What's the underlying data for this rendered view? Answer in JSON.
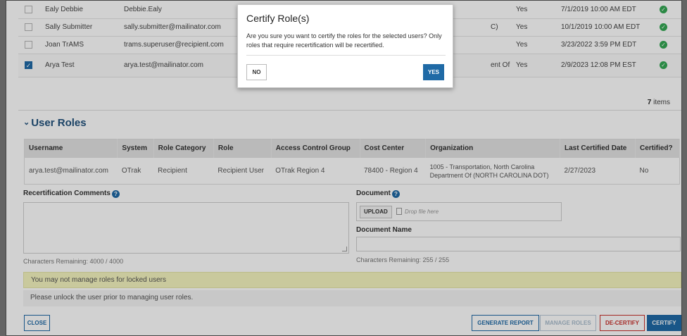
{
  "users": {
    "rows": [
      {
        "name": "Ealy Debbie",
        "username": "Debbie.Ealy",
        "col6": "",
        "col7": "Yes",
        "date": "7/1/2019 10:00 AM EDT",
        "checked": false
      },
      {
        "name": "Sally Submitter",
        "username": "sally.submitter@mailinator.com",
        "col6": "C)",
        "col7": "Yes",
        "date": "10/1/2019 10:00 AM EDT",
        "checked": false
      },
      {
        "name": "Joan TrAMS",
        "username": "trams.superuser@recipient.com",
        "col6": "",
        "col7": "Yes",
        "date": "3/23/2022 3:59 PM EDT",
        "checked": false
      },
      {
        "name": "Arya Test",
        "username": "arya.test@mailinator.com",
        "col6": "ent Of",
        "col7": "Yes",
        "date": "2/9/2023 12:08 PM EST",
        "checked": true
      }
    ],
    "count": "7",
    "count_suffix": " items"
  },
  "user_roles": {
    "title": "User Roles",
    "headers": [
      "Username",
      "System",
      "Role Category",
      "Role",
      "Access Control Group",
      "Cost Center",
      "Organization",
      "Last Certified Date",
      "Certified?"
    ],
    "row": {
      "username": "arya.test@mailinator.com",
      "system": "OTrak",
      "role_category": "Recipient",
      "role": "Recipient User",
      "acg": "OTrak Region 4",
      "cost_center": "78400 - Region 4",
      "org_line1": "1005 - Transportation, North Carolina",
      "org_line2": "Department Of (NORTH CAROLINA DOT)",
      "last_certified": "2/27/2023",
      "certified": "No"
    }
  },
  "form": {
    "comments_label": "Recertification Comments",
    "comments_remaining": "Characters Remaining: 4000 / 4000",
    "document_label": "Document",
    "upload_label": "UPLOAD",
    "drop_hint": "Drop file here",
    "docname_label": "Document Name",
    "docname_remaining": "Characters Remaining: 255 / 255"
  },
  "alerts": {
    "warning": "You may not manage roles for locked users",
    "note": "Please unlock the user prior to managing user roles."
  },
  "buttons": {
    "close": "CLOSE",
    "generate": "GENERATE REPORT",
    "manage": "MANAGE ROLES",
    "decertify": "DE-CERTIFY",
    "certify": "CERTIFY"
  },
  "modal": {
    "title": "Certify Role(s)",
    "message": "Are you sure you want to certify the roles for the selected users? Only roles that require recertification will be recertified.",
    "no": "NO",
    "yes": "YES"
  },
  "colors": {
    "accent": "#1f6aa6",
    "danger": "#c9302c",
    "success": "#34a853",
    "warning_bg": "#f6f6c0"
  }
}
